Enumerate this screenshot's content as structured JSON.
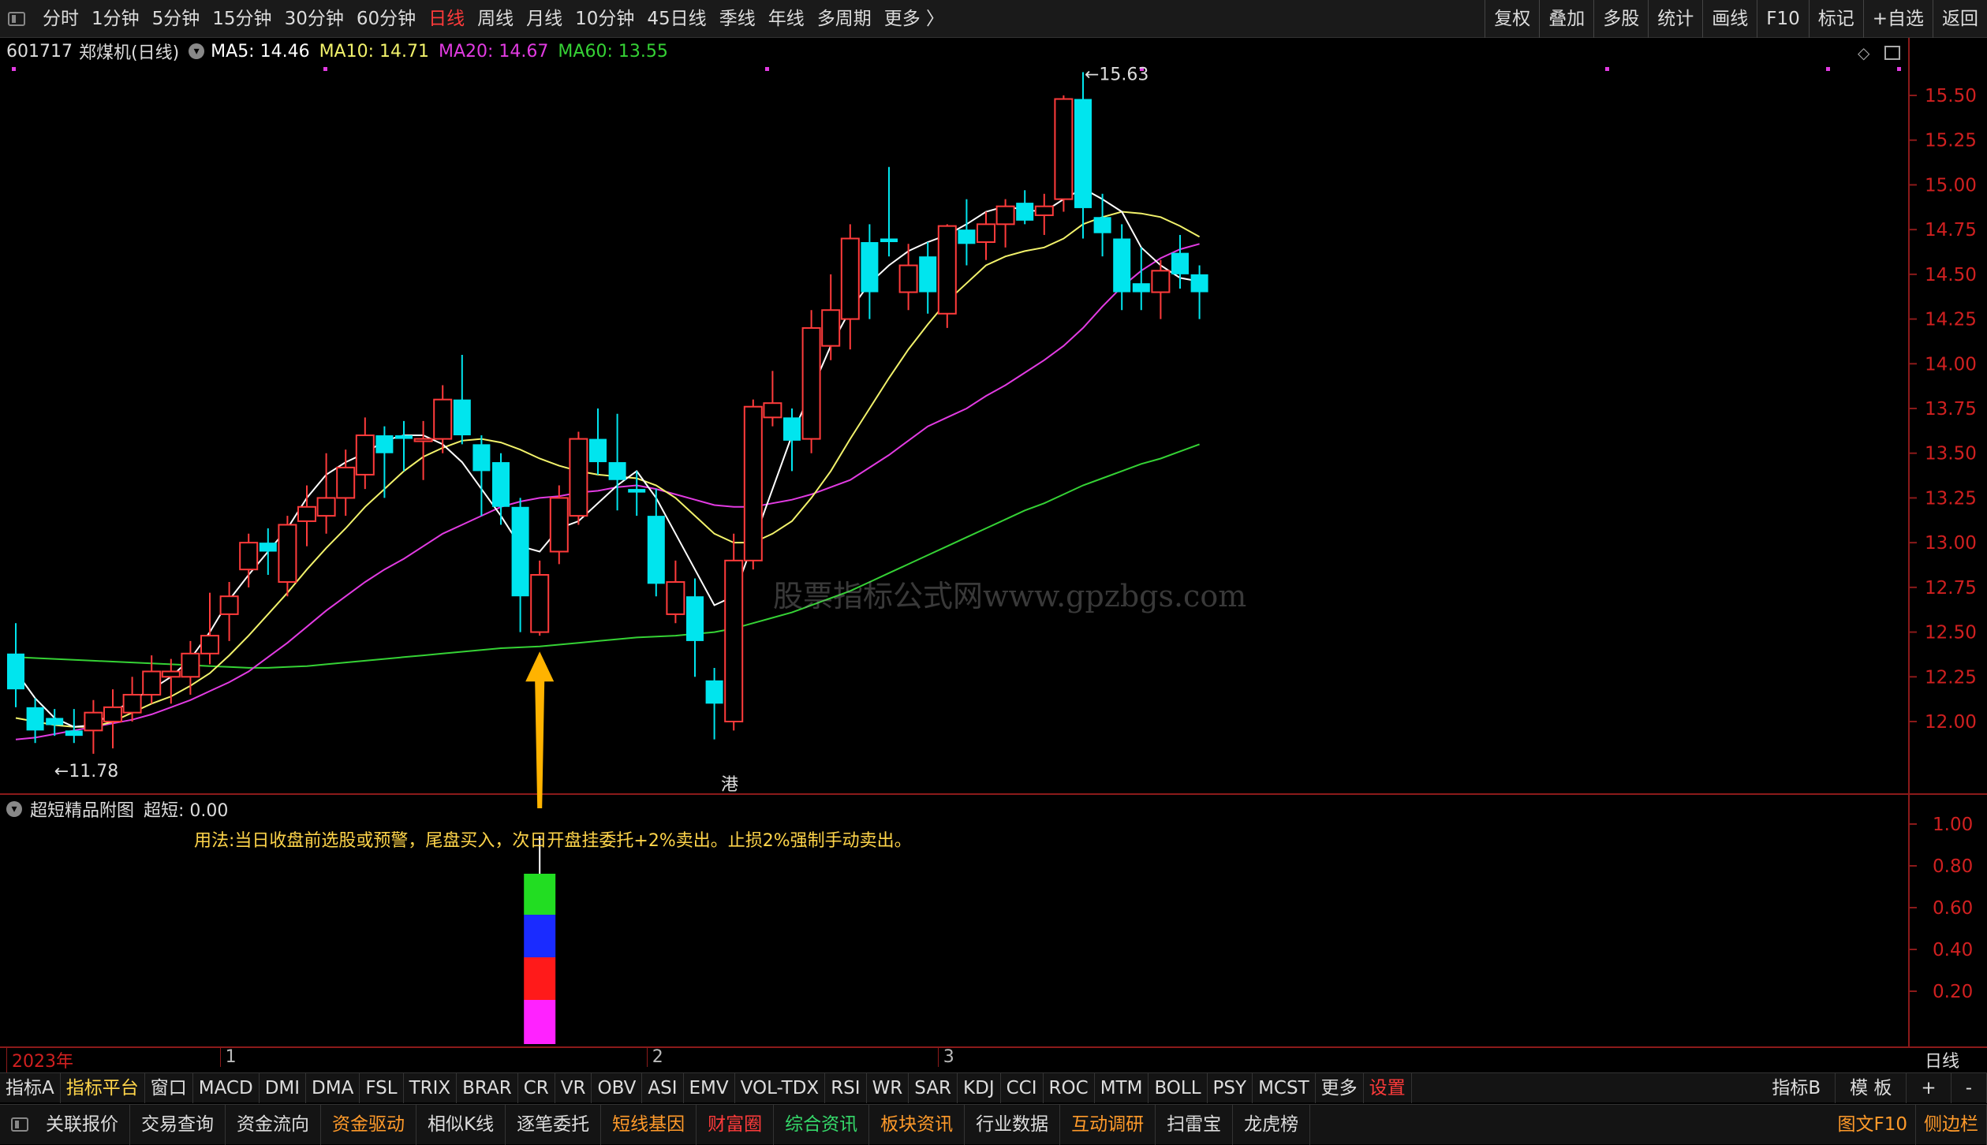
{
  "topbar": {
    "periods": [
      "分时",
      "1分钟",
      "5分钟",
      "15分钟",
      "30分钟",
      "60分钟",
      "日线",
      "周线",
      "月线",
      "10分钟",
      "45日线",
      "季线",
      "年线",
      "多周期",
      "更多 〉"
    ],
    "active_period": "日线",
    "right_buttons": [
      "复权",
      "叠加",
      "多股",
      "统计",
      "画线",
      "F10",
      "标记",
      "+自选",
      "返回"
    ]
  },
  "stock": {
    "code": "601717",
    "name": "郑煤机(日线)",
    "ma5": "MA5: 14.46",
    "ma10": "MA10: 14.71",
    "ma20": "MA20: 14.67",
    "ma60": "MA60: 13.55"
  },
  "colors": {
    "up": "#ff3b3b",
    "down": "#00e5ee",
    "ma5": "#ffffff",
    "ma10": "#f2f26b",
    "ma20": "#e23be2",
    "ma60": "#35d235",
    "usage_text": "#ffd54a",
    "active": "#ff3b3b"
  },
  "chart_data": {
    "type": "candlestick",
    "y_ticks": [
      "15.50",
      "15.25",
      "15.00",
      "14.75",
      "14.50",
      "14.25",
      "14.00",
      "13.75",
      "13.50",
      "13.25",
      "13.00",
      "12.75",
      "12.50",
      "12.25",
      "12.00"
    ],
    "ylim": [
      11.55,
      15.82
    ],
    "candles": [
      [
        12.38,
        12.18,
        12.55,
        12.08
      ],
      [
        12.08,
        11.95,
        12.13,
        11.88
      ],
      [
        12.02,
        11.98,
        12.07,
        11.92
      ],
      [
        11.95,
        11.92,
        12.07,
        11.88
      ],
      [
        11.95,
        12.05,
        12.12,
        11.82
      ],
      [
        12.0,
        12.08,
        12.18,
        11.85
      ],
      [
        12.05,
        12.15,
        12.25,
        12.0
      ],
      [
        12.15,
        12.28,
        12.37,
        12.1
      ],
      [
        12.25,
        12.28,
        12.35,
        12.1
      ],
      [
        12.25,
        12.38,
        12.45,
        12.15
      ],
      [
        12.38,
        12.48,
        12.72,
        12.32
      ],
      [
        12.6,
        12.7,
        12.78,
        12.45
      ],
      [
        12.85,
        13.0,
        13.05,
        12.75
      ],
      [
        13.0,
        12.95,
        13.08,
        12.82
      ],
      [
        12.78,
        13.1,
        13.15,
        12.7
      ],
      [
        13.12,
        13.2,
        13.32,
        12.98
      ],
      [
        13.15,
        13.25,
        13.5,
        13.05
      ],
      [
        13.25,
        13.42,
        13.52,
        13.15
      ],
      [
        13.38,
        13.6,
        13.7,
        13.3
      ],
      [
        13.6,
        13.5,
        13.65,
        13.25
      ],
      [
        13.6,
        13.58,
        13.68,
        13.4
      ],
      [
        13.58,
        13.58,
        13.68,
        13.35
      ],
      [
        13.58,
        13.8,
        13.88,
        13.5
      ],
      [
        13.8,
        13.6,
        14.05,
        13.55
      ],
      [
        13.55,
        13.4,
        13.6,
        13.15
      ],
      [
        13.45,
        13.2,
        13.5,
        13.1
      ],
      [
        13.2,
        12.7,
        13.25,
        12.5
      ],
      [
        12.5,
        12.82,
        12.9,
        12.48
      ],
      [
        12.95,
        13.25,
        13.32,
        12.88
      ],
      [
        13.15,
        13.58,
        13.62,
        13.1
      ],
      [
        13.58,
        13.45,
        13.75,
        13.38
      ],
      [
        13.45,
        13.35,
        13.72,
        13.18
      ],
      [
        13.3,
        13.28,
        13.4,
        13.15
      ],
      [
        13.15,
        12.77,
        13.3,
        12.7
      ],
      [
        12.6,
        12.78,
        12.9,
        12.55
      ],
      [
        12.7,
        12.45,
        12.8,
        12.25
      ],
      [
        12.23,
        12.1,
        12.3,
        11.9
      ],
      [
        12.0,
        12.9,
        13.05,
        11.95
      ],
      [
        12.9,
        13.76,
        13.8,
        12.85
      ],
      [
        13.7,
        13.78,
        13.96,
        13.65
      ],
      [
        13.7,
        13.57,
        13.75,
        13.4
      ],
      [
        13.58,
        14.2,
        14.3,
        13.5
      ],
      [
        14.1,
        14.3,
        14.5,
        14.02
      ],
      [
        14.25,
        14.7,
        14.78,
        14.08
      ],
      [
        14.68,
        14.4,
        14.78,
        14.25
      ],
      [
        14.7,
        14.68,
        15.1,
        14.6
      ],
      [
        14.4,
        14.55,
        14.67,
        14.3
      ],
      [
        14.6,
        14.4,
        14.68,
        14.28
      ],
      [
        14.28,
        14.77,
        14.78,
        14.2
      ],
      [
        14.75,
        14.67,
        14.92,
        14.55
      ],
      [
        14.68,
        14.78,
        14.85,
        14.58
      ],
      [
        14.78,
        14.88,
        14.92,
        14.65
      ],
      [
        14.9,
        14.8,
        14.97,
        14.78
      ],
      [
        14.83,
        14.88,
        14.95,
        14.72
      ],
      [
        14.92,
        15.48,
        15.5,
        14.85
      ],
      [
        15.48,
        14.87,
        15.63,
        14.7
      ],
      [
        14.82,
        14.73,
        14.95,
        14.6
      ],
      [
        14.7,
        14.4,
        14.78,
        14.3
      ],
      [
        14.45,
        14.4,
        14.65,
        14.3
      ],
      [
        14.4,
        14.52,
        14.58,
        14.25
      ],
      [
        14.62,
        14.5,
        14.72,
        14.42
      ],
      [
        14.5,
        14.4,
        14.55,
        14.25
      ]
    ],
    "ma5": [
      12.28,
      12.13,
      12.02,
      11.97,
      11.98,
      12.05,
      12.12,
      12.18,
      12.25,
      12.35,
      12.5,
      12.68,
      12.82,
      12.95,
      13.08,
      13.25,
      13.38,
      13.45,
      13.5,
      13.57,
      13.6,
      13.6,
      13.55,
      13.45,
      13.3,
      13.15,
      12.98,
      12.95,
      13.08,
      13.12,
      13.22,
      13.32,
      13.4,
      13.25,
      13.05,
      12.85,
      12.65,
      12.7,
      13.0,
      13.3,
      13.6,
      13.85,
      14.1,
      14.3,
      14.45,
      14.55,
      14.63,
      14.68,
      14.72,
      14.78,
      14.85,
      14.88,
      14.86,
      14.85,
      14.92,
      14.98,
      14.92,
      14.85,
      14.65,
      14.55,
      14.48,
      14.46
    ],
    "ma10": [
      12.02,
      12.0,
      11.98,
      11.97,
      11.97,
      12.0,
      12.05,
      12.1,
      12.14,
      12.2,
      12.27,
      12.37,
      12.48,
      12.6,
      12.72,
      12.85,
      12.97,
      13.08,
      13.2,
      13.3,
      13.4,
      13.48,
      13.53,
      13.57,
      13.58,
      13.56,
      13.52,
      13.47,
      13.43,
      13.4,
      13.38,
      13.37,
      13.36,
      13.32,
      13.25,
      13.15,
      13.05,
      13.0,
      13.0,
      13.05,
      13.12,
      13.25,
      13.4,
      13.58,
      13.75,
      13.92,
      14.08,
      14.22,
      14.35,
      14.45,
      14.55,
      14.6,
      14.63,
      14.65,
      14.7,
      14.78,
      14.82,
      14.85,
      14.84,
      14.82,
      14.77,
      14.71
    ],
    "ma20": [
      11.9,
      11.91,
      11.93,
      11.95,
      11.97,
      11.99,
      12.01,
      12.04,
      12.08,
      12.12,
      12.17,
      12.22,
      12.28,
      12.36,
      12.44,
      12.53,
      12.62,
      12.7,
      12.78,
      12.85,
      12.91,
      12.98,
      13.05,
      13.1,
      13.15,
      13.2,
      13.23,
      13.25,
      13.26,
      13.28,
      13.29,
      13.31,
      13.32,
      13.3,
      13.27,
      13.24,
      13.21,
      13.2,
      13.2,
      13.22,
      13.24,
      13.27,
      13.31,
      13.35,
      13.42,
      13.49,
      13.57,
      13.65,
      13.7,
      13.75,
      13.82,
      13.88,
      13.95,
      14.02,
      14.1,
      14.2,
      14.32,
      14.43,
      14.52,
      14.59,
      14.64,
      14.67
    ],
    "ma60": [
      12.36,
      12.355,
      12.35,
      12.345,
      12.34,
      12.335,
      12.33,
      12.325,
      12.32,
      12.315,
      12.31,
      12.305,
      12.3,
      12.3,
      12.305,
      12.31,
      12.32,
      12.33,
      12.34,
      12.35,
      12.36,
      12.37,
      12.38,
      12.39,
      12.4,
      12.41,
      12.415,
      12.42,
      12.43,
      12.44,
      12.45,
      12.46,
      12.47,
      12.475,
      12.48,
      12.49,
      12.5,
      12.52,
      12.55,
      12.58,
      12.61,
      12.65,
      12.69,
      12.73,
      12.78,
      12.83,
      12.88,
      12.93,
      12.98,
      13.03,
      13.08,
      13.13,
      13.18,
      13.22,
      13.27,
      13.32,
      13.36,
      13.4,
      13.44,
      13.47,
      13.51,
      13.55
    ],
    "high_label": "15.63",
    "low_label": "11.78"
  },
  "sub": {
    "title": "超短精品附图",
    "value": "超短: 0.00",
    "usage": "用法:当日收盘前选股或预警，尾盘买入，次日开盘挂委托+2%卖出。止损2%强制手动卖出。",
    "y_ticks": [
      "1.00",
      "0.80",
      "0.60",
      "0.40",
      "0.20"
    ],
    "blocks": [
      "#ff22ff",
      "#ff1a1a",
      "#1a2bff",
      "#22dd22"
    ]
  },
  "watermark": "股票指标公式网www.gpzbgs.com",
  "gang_label": "港",
  "time_axis": {
    "labels": [
      {
        "text": "2023年",
        "color": "#d02020",
        "idx": 0
      },
      {
        "text": "1",
        "color": "#bbbbbb",
        "idx": 11
      },
      {
        "text": "2",
        "color": "#bbbbbb",
        "idx": 33
      },
      {
        "text": "3",
        "color": "#bbbbbb",
        "idx": 48
      }
    ],
    "period": "日线"
  },
  "indicators": [
    "指标A",
    "指标平台",
    "窗口",
    "MACD",
    "DMI",
    "DMA",
    "FSL",
    "TRIX",
    "BRAR",
    "CR",
    "VR",
    "OBV",
    "ASI",
    "EMV",
    "VOL-TDX",
    "RSI",
    "WR",
    "SAR",
    "KDJ",
    "CCI",
    "ROC",
    "MTM",
    "BOLL",
    "PSY",
    "MCST",
    "更多",
    "设置"
  ],
  "indicators_right": [
    "指标B",
    "模 板",
    "+",
    "-"
  ],
  "bottom": [
    {
      "t": "关联报价",
      "c": ""
    },
    {
      "t": "交易查询",
      "c": ""
    },
    {
      "t": "资金流向",
      "c": ""
    },
    {
      "t": "资金驱动",
      "c": "o"
    },
    {
      "t": "相似K线",
      "c": ""
    },
    {
      "t": "逐笔委托",
      "c": ""
    },
    {
      "t": "短线基因",
      "c": "o"
    },
    {
      "t": "财富圈",
      "c": "r"
    },
    {
      "t": "综合资讯",
      "c": "g"
    },
    {
      "t": "板块资讯",
      "c": "o"
    },
    {
      "t": "行业数据",
      "c": ""
    },
    {
      "t": "互动调研",
      "c": "o"
    },
    {
      "t": "扫雷宝",
      "c": ""
    },
    {
      "t": "龙虎榜",
      "c": ""
    }
  ],
  "bottom_right": [
    "图文F10",
    "侧边栏"
  ]
}
